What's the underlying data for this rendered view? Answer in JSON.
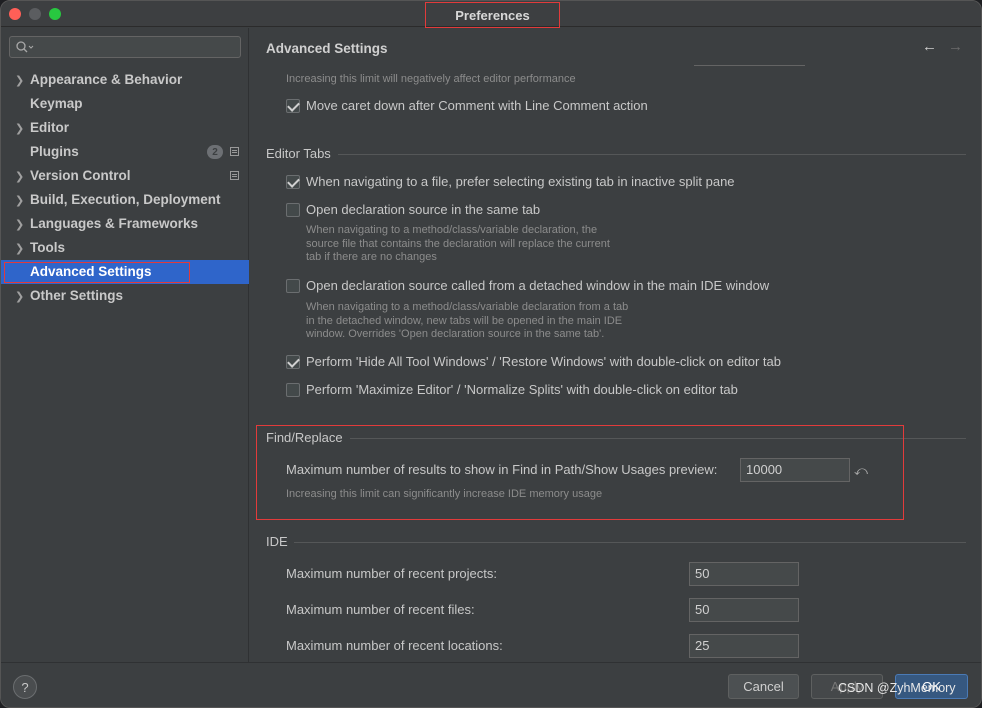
{
  "window": {
    "title": "Preferences"
  },
  "search": {
    "placeholder": ""
  },
  "sidebar": {
    "items": [
      {
        "label": "Appearance & Behavior",
        "expandable": true
      },
      {
        "label": "Keymap",
        "expandable": false
      },
      {
        "label": "Editor",
        "expandable": true
      },
      {
        "label": "Plugins",
        "expandable": false,
        "badge": "2"
      },
      {
        "label": "Version Control",
        "expandable": true
      },
      {
        "label": "Build, Execution, Deployment",
        "expandable": true
      },
      {
        "label": "Languages & Frameworks",
        "expandable": true
      },
      {
        "label": "Tools",
        "expandable": true
      },
      {
        "label": "Advanced Settings",
        "expandable": false,
        "selected": true
      },
      {
        "label": "Other Settings",
        "expandable": true
      }
    ]
  },
  "main": {
    "title": "Advanced Settings",
    "top_hint": "Increasing this limit will negatively affect editor performance",
    "move_caret": {
      "label": "Move caret down after Comment with Line Comment action",
      "checked": true
    },
    "editor_tabs": {
      "heading": "Editor Tabs",
      "options": [
        {
          "label": "When navigating to a file, prefer selecting existing tab in inactive split pane",
          "checked": true,
          "hint": []
        },
        {
          "label": "Open declaration source in the same tab",
          "checked": false,
          "hint": [
            "When navigating to a method/class/variable declaration, the",
            "source file that contains the declaration will replace the current",
            "tab if there are no changes"
          ]
        },
        {
          "label": "Open declaration source called from a detached window in the main IDE window",
          "checked": false,
          "hint": [
            "When navigating to a method/class/variable declaration from a tab",
            "in the detached window, new tabs will be opened in the main IDE",
            "window. Overrides 'Open declaration source in the same tab'."
          ]
        },
        {
          "label": "Perform 'Hide All Tool Windows' / 'Restore Windows' with double-click on editor tab",
          "checked": true,
          "hint": []
        },
        {
          "label": "Perform 'Maximize Editor' / 'Normalize Splits' with double-click on editor tab",
          "checked": false,
          "hint": []
        }
      ]
    },
    "find_replace": {
      "heading": "Find/Replace",
      "max_results_label": "Maximum number of results to show in Find in Path/Show Usages preview:",
      "max_results_value": "10000",
      "hint": "Increasing this limit can significantly increase IDE memory usage"
    },
    "ide": {
      "heading": "IDE",
      "fields": [
        {
          "label": "Maximum number of recent projects:",
          "value": "50"
        },
        {
          "label": "Maximum number of recent files:",
          "value": "50"
        },
        {
          "label": "Maximum number of recent locations:",
          "value": "25"
        }
      ]
    }
  },
  "footer": {
    "help_label": "?",
    "cancel_label": "Cancel",
    "apply_label": "Apply",
    "ok_label": "OK"
  },
  "watermark": "CSDN @ZyhMemory",
  "colors": {
    "accent": "#2f65ca",
    "annotation": "#e23b3b",
    "ok_button": "#365880"
  }
}
